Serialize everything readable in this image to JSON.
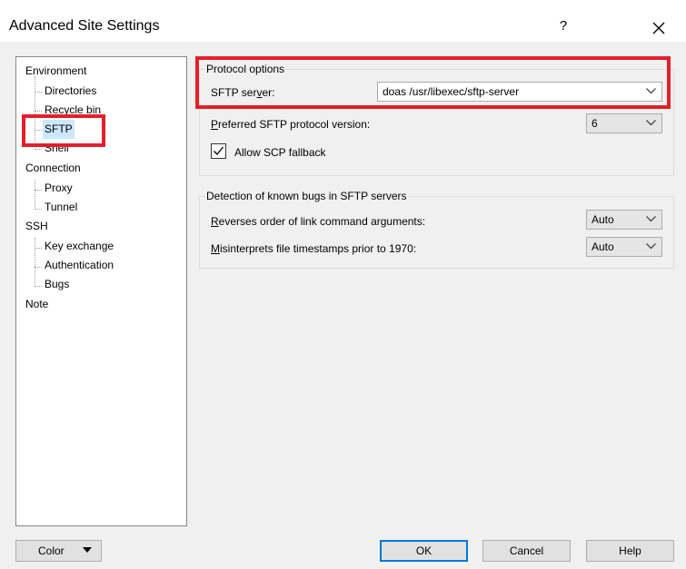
{
  "window": {
    "title": "Advanced Site Settings",
    "help_label": "?"
  },
  "sidebar": {
    "items": [
      {
        "label": "Environment"
      },
      {
        "label": "Directories"
      },
      {
        "label": "Recycle bin"
      },
      {
        "label": "SFTP",
        "selected": true
      },
      {
        "label": "Shell"
      },
      {
        "label": "Connection"
      },
      {
        "label": "Proxy"
      },
      {
        "label": "Tunnel"
      },
      {
        "label": "SSH"
      },
      {
        "label": "Key exchange"
      },
      {
        "label": "Authentication"
      },
      {
        "label": "Bugs"
      },
      {
        "label": "Note"
      }
    ]
  },
  "protocol_options": {
    "title": "Protocol options",
    "sftp_server": {
      "label_pre": "SFTP ser",
      "label_u": "v",
      "label_post": "er:",
      "value": "doas /usr/libexec/sftp-server"
    },
    "protocol_version": {
      "label_u": "P",
      "label_post": "referred SFTP protocol version:",
      "value": "6"
    },
    "scp_fallback": {
      "label": "Allow SCP fallback",
      "checked": true
    }
  },
  "bugs": {
    "title": "Detection of known bugs in SFTP servers",
    "reverse_link": {
      "label_u": "R",
      "label_post": "everses order of link command arguments:",
      "value": "Auto"
    },
    "timestamps": {
      "label_u": "M",
      "label_post": "isinterprets file timestamps prior to 1970:",
      "value": "Auto"
    }
  },
  "buttons": {
    "color": "Color",
    "ok": "OK",
    "cancel": "Cancel",
    "help": "Help"
  },
  "colors": {
    "highlight": "#e41f2a",
    "selection": "#cce8ff",
    "default_button_border": "#0078d7"
  }
}
